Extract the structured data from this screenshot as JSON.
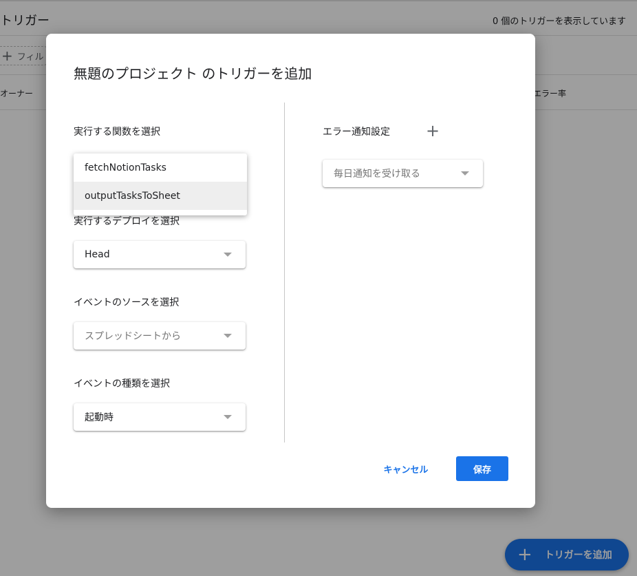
{
  "background": {
    "page_title": "トリガー",
    "trigger_count": "0 個のトリガーを表示しています",
    "filter_label": "フィル",
    "columns": {
      "owner": "オーナー",
      "error_rate": "エラー率"
    },
    "fab_label": "トリガーを追加"
  },
  "dialog": {
    "title": "無題のプロジェクト のトリガーを追加",
    "function_label": "実行する関数を選択",
    "function_options": [
      "fetchNotionTasks",
      "outputTasksToSheet"
    ],
    "deployment_label": "実行するデプロイを選択",
    "deployment_value": "Head",
    "event_source_label": "イベントのソースを選択",
    "event_source_value": "スプレッドシートから",
    "event_type_label": "イベントの種類を選択",
    "event_type_value": "起動時",
    "error_notify_label": "エラー通知設定",
    "error_notify_value": "毎日通知を受け取る",
    "cancel_label": "キャンセル",
    "save_label": "保存"
  },
  "icons": {
    "add_notification": "plus-icon",
    "fab_icon": "plus-icon",
    "filter_icon": "plus-icon",
    "dropdown_caret": "caret-down-icon"
  },
  "colors": {
    "accent": "#1a73e8",
    "scrim": "rgba(0,0,0,0.38)"
  }
}
